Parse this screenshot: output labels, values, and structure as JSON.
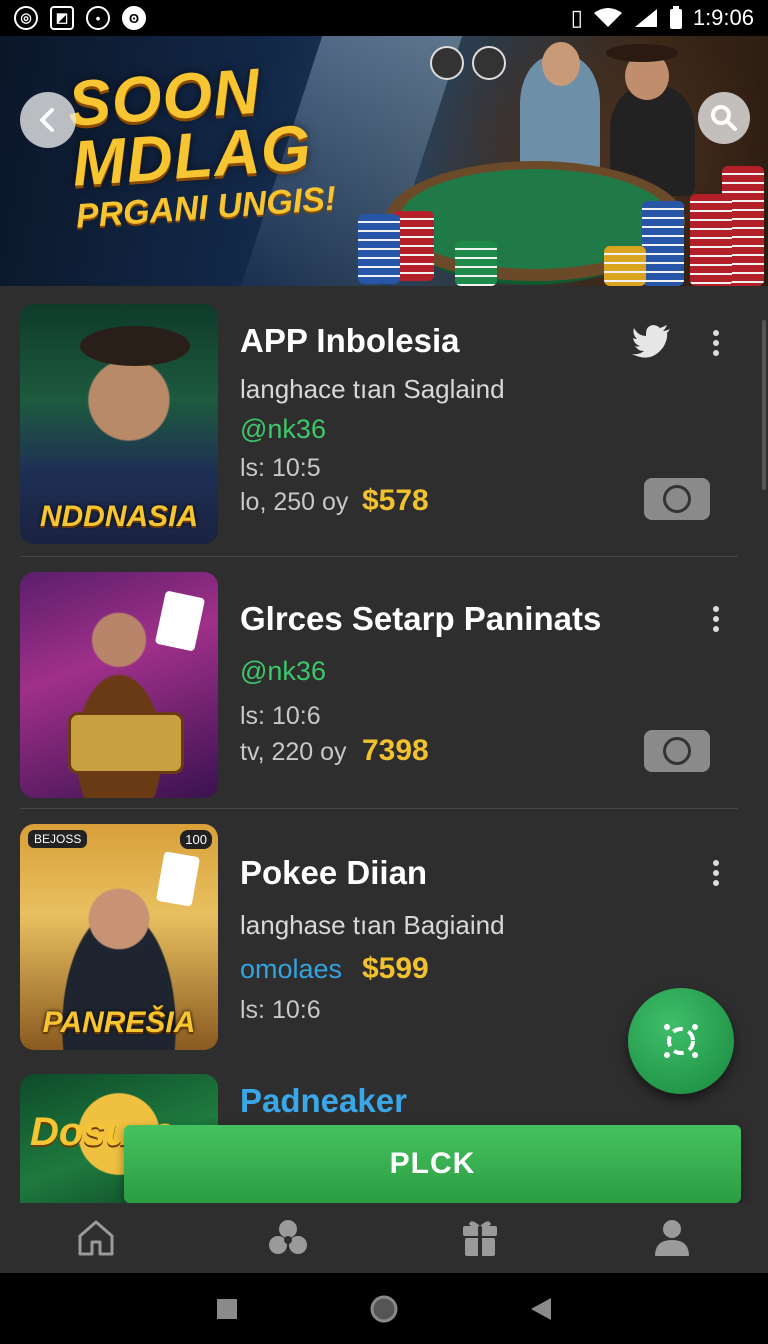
{
  "status_bar": {
    "time": "1:9:06",
    "left_icons": [
      "messenger-icon",
      "gallery-icon",
      "clock-icon",
      "nfc-icon"
    ],
    "right_icons": [
      "vibrate-icon",
      "wifi-icon",
      "signal-icon",
      "battery-icon"
    ]
  },
  "hero": {
    "title_line1": "SOON",
    "title_line2": "MDLAG",
    "title_line3": "PRGANI UNGIS!"
  },
  "items": [
    {
      "title": "APP Inbolesia",
      "subtitle": "langhace tıan Saglaind",
      "handle": "@nk36",
      "meta1": "ls: 10:5",
      "meta2": "lo, 250 oy",
      "price": "$578",
      "thumb_caption": "NDDNASIA",
      "social_icon": "twitter-bird-icon"
    },
    {
      "title": "Glrces Setarp Paninats",
      "handle": "@nk36",
      "meta1": "ls: 10:6",
      "meta2": "tv, 220 oy",
      "price": "7398"
    },
    {
      "title": "Pokee Diian",
      "subtitle": "langhase tıan Bagiaind",
      "handle": "omolaes",
      "price": "$599",
      "meta1": "ls: 10:6",
      "thumb_caption": "PANREŠIA",
      "thumb_badge_left": "BEJOSS",
      "thumb_badge_right": "100"
    },
    {
      "title": "Padneaker",
      "thumb_caption": "Dosuse"
    }
  ],
  "cta_label": "PLCK",
  "bottom_nav": [
    "home-icon",
    "community-icon",
    "gift-icon",
    "profile-icon"
  ],
  "colors": {
    "accent_green": "#2b9d43",
    "price_gold": "#f2c22e",
    "handle_green": "#3cc86a",
    "handle_blue": "#33a4e0",
    "title_blue": "#3aa8e8"
  }
}
